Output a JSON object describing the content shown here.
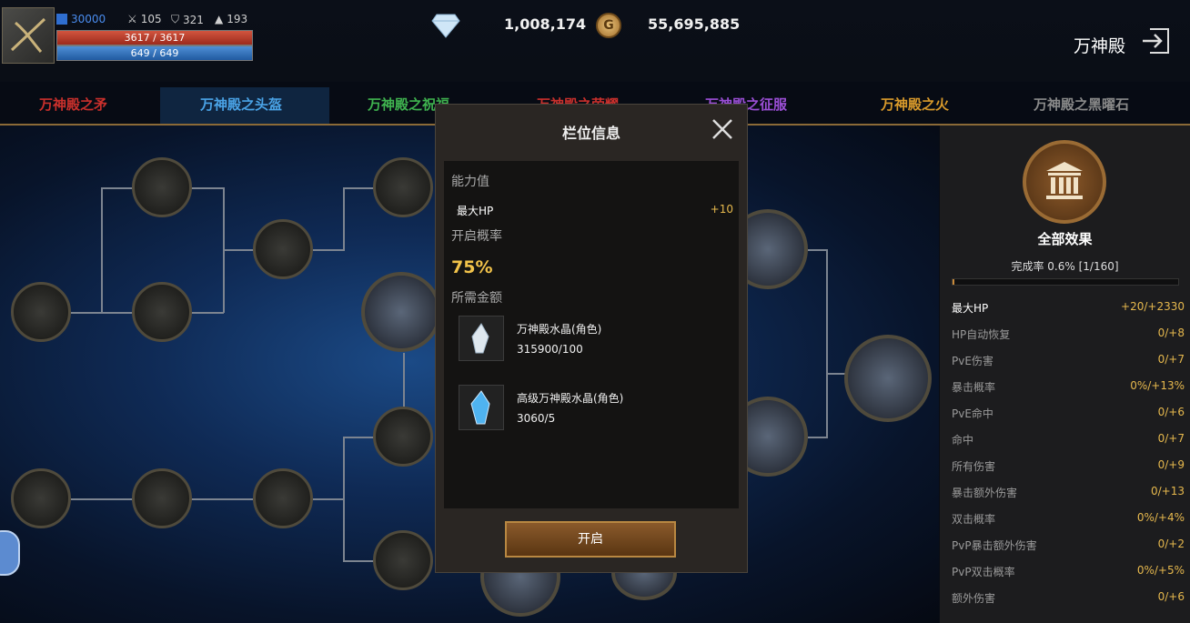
{
  "player": {
    "power": "30000",
    "attack": "105",
    "defense": "321",
    "magic": "193",
    "hp": "3617 / 3617",
    "mp": "649 / 649"
  },
  "currency": {
    "diamonds": "1,008,174",
    "coin_symbol": "G",
    "gold": "55,695,885"
  },
  "header": {
    "title": "万神殿"
  },
  "tabs": [
    {
      "label": "万神殿之矛",
      "color": "#c9302c"
    },
    {
      "label": "万神殿之头盔",
      "color": "#4aa3e6"
    },
    {
      "label": "万神殿之祝福",
      "color": "#3fb34f"
    },
    {
      "label": "万神殿之荣耀",
      "color": "#c9302c"
    },
    {
      "label": "万神殿之征服",
      "color": "#9b4fd6"
    },
    {
      "label": "万神殿之火",
      "color": "#d99a2b"
    },
    {
      "label": "万神殿之黑曜石",
      "color": "#8a8a8a"
    }
  ],
  "modal": {
    "title": "栏位信息",
    "ability_label": "能力值",
    "stat_name": "最大HP",
    "stat_value": "+10",
    "chance_label": "开启概率",
    "chance_value": "75%",
    "cost_label": "所需金额",
    "items": [
      {
        "name": "万神殿水晶(角色)",
        "qty": "315900/100"
      },
      {
        "name": "高级万神殿水晶(角色)",
        "qty": "3060/5"
      }
    ],
    "open_label": "开启"
  },
  "panel": {
    "title": "全部效果",
    "completion": "完成率 0.6% [1/160]",
    "progress": 0.006,
    "effects": [
      {
        "name": "最大HP",
        "value": "+20/+2330"
      },
      {
        "name": "HP自动恢复",
        "value": "0/+8"
      },
      {
        "name": "PvE伤害",
        "value": "0/+7"
      },
      {
        "name": "暴击概率",
        "value": "0%/+13%"
      },
      {
        "name": "PvE命中",
        "value": "0/+6"
      },
      {
        "name": "命中",
        "value": "0/+7"
      },
      {
        "name": "所有伤害",
        "value": "0/+9"
      },
      {
        "name": "暴击额外伤害",
        "value": "0/+13"
      },
      {
        "name": "双击概率",
        "value": "0%/+4%"
      },
      {
        "name": "PvP暴击额外伤害",
        "value": "0/+2"
      },
      {
        "name": "PvP双击概率",
        "value": "0%/+5%"
      },
      {
        "name": "额外伤害",
        "value": "0/+6"
      }
    ]
  },
  "colors": {
    "accent_gold": "#e6b84d",
    "hp_red": "#9c2a1c",
    "mp_blue": "#205aa0"
  }
}
